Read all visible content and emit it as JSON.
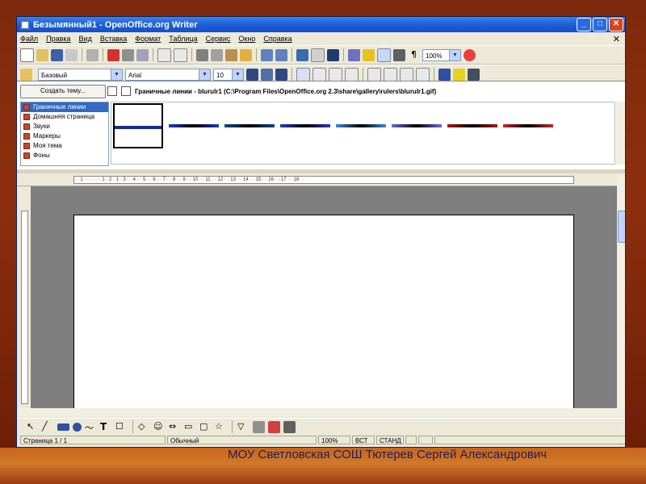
{
  "window": {
    "title": "Безымянный1 - OpenOffice.org Writer",
    "controls": {
      "minimize": "_",
      "maximize": "□",
      "close": "✕"
    }
  },
  "menu": {
    "items": [
      "Файл",
      "Правка",
      "Вид",
      "Вставка",
      "Формат",
      "Таблица",
      "Сервис",
      "Окно",
      "Справка"
    ],
    "close_doc": "✕"
  },
  "format_toolbar": {
    "style_value": "Базовый",
    "font_value": "Arial",
    "size_value": "10",
    "zoom_value": "100%"
  },
  "gallery": {
    "create_theme_label": "Создать тему...",
    "themes": [
      "Граничные линии",
      "Домашняя страница",
      "Звуки",
      "Маркеры",
      "Моя тема",
      "Фоны"
    ],
    "selected_theme_index": 0,
    "path_label": "Граничные линии - blurulr1 (C:\\Program Files\\OpenOffice.org 2.3\\share\\gallery\\rulers\\blurulr1.gif)",
    "item_colors": [
      "#1a2a8a",
      "#1b3ac8",
      "#0a4a8a",
      "#2a3ab8",
      "#3a8ad8",
      "#6a6ad8",
      "#a81818",
      "#c82828"
    ]
  },
  "ruler": {
    "numbers": "· · 1 · · · · · · 1 · 2 · 1 · 3 · · 4 · · 5 · · 6 · · 7 · · 8 · · 9 · · 10 · · 11 · · 12 · · 13 · · 14 · · 15 · · 16 · · 17 · · 18 · ·"
  },
  "status": {
    "page": "Страница  1 / 1",
    "style": "Обычный",
    "zoom": "100%",
    "insert": "ВСТ",
    "select": "СТАНД"
  },
  "caption": "МОУ Светловская СОШ Тютерев Сергей Александрович"
}
